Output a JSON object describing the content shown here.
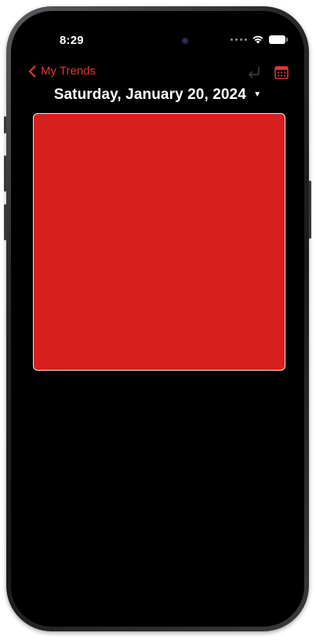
{
  "status_bar": {
    "time": "8:29"
  },
  "nav": {
    "back_label": "My Trends",
    "back_icon": "chevron-left-icon",
    "undo_icon": "undo-icon",
    "calendar_icon": "calendar-icon"
  },
  "date_picker": {
    "label": "Saturday, January 20, 2024",
    "caret": "▼"
  },
  "tile": {
    "color": "#d71f1f"
  },
  "colors": {
    "accent": "#d93a32",
    "background": "#000000"
  }
}
